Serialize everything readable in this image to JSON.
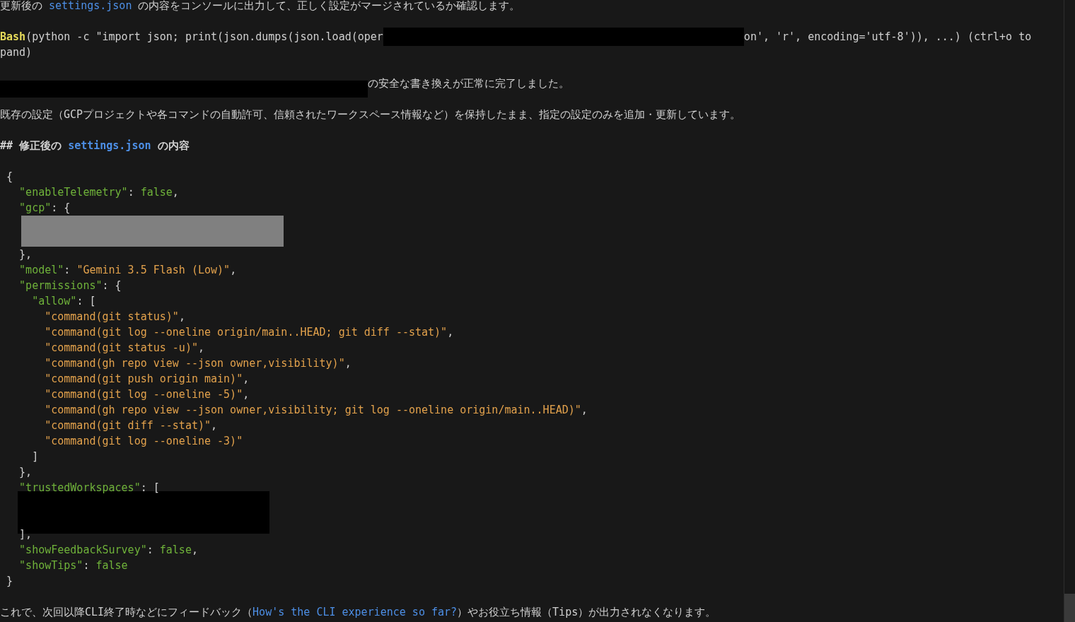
{
  "lines": [
    {
      "kind": "prose",
      "segs": [
        {
          "t": "更新後の ",
          "kind": "plain"
        },
        {
          "t": "settings.json",
          "kind": "link"
        },
        {
          "t": " の内容をコンソールに出力して、正しく設定がマージされているか確認します。",
          "kind": "plain"
        }
      ]
    },
    {
      "kind": "blank"
    },
    {
      "kind": "tool",
      "segs": [
        {
          "t": "Bash",
          "kind": "tool"
        },
        {
          "t": "(python -c \"import json; print(json.dumps(json.load(oper",
          "kind": "plain"
        },
        {
          "kind": "mask",
          "color": "#000000"
        },
        {
          "t": "on', 'r', encoding='utf-8')), ...) (ctrl+o to",
          "kind": "plain"
        }
      ]
    },
    {
      "kind": "tool",
      "segs": [
        {
          "t": "pand)",
          "kind": "plain"
        }
      ]
    },
    {
      "kind": "blank"
    },
    {
      "kind": "prose",
      "segs": [
        {
          "kind": "mask",
          "color": "#000000"
        },
        {
          "t": "の安全な書き換えが正常に完了しました。",
          "kind": "plain"
        }
      ]
    },
    {
      "kind": "blank"
    },
    {
      "kind": "prose",
      "segs": [
        {
          "t": "既存の設定（GCPプロジェクトや各コマンドの自動許可、信頼されたワークスペース情報など）を保持したまま、指定の設定のみを追加・更新しています。",
          "kind": "plain"
        }
      ]
    },
    {
      "kind": "blank"
    },
    {
      "kind": "heading",
      "segs": [
        {
          "t": "## 修正後の ",
          "kind": "plain"
        },
        {
          "t": "settings.json",
          "kind": "link"
        },
        {
          "t": " の内容",
          "kind": "plain"
        }
      ]
    },
    {
      "kind": "blank"
    },
    {
      "kind": "code",
      "segs": [
        {
          "t": " {",
          "kind": "punct"
        }
      ]
    },
    {
      "kind": "code",
      "segs": [
        {
          "t": "   \"enableTelemetry\"",
          "kind": "key"
        },
        {
          "t": ": ",
          "kind": "punct"
        },
        {
          "t": "false",
          "kind": "bool"
        },
        {
          "t": ",",
          "kind": "punct"
        }
      ]
    },
    {
      "kind": "code",
      "segs": [
        {
          "t": "   \"gcp\"",
          "kind": "key"
        },
        {
          "t": ": {",
          "kind": "punct"
        }
      ]
    },
    {
      "kind": "mask",
      "color": "#808080"
    },
    {
      "kind": "code",
      "segs": [
        {
          "t": "   },",
          "kind": "punct"
        }
      ]
    },
    {
      "kind": "code",
      "segs": [
        {
          "t": "   \"model\"",
          "kind": "key"
        },
        {
          "t": ": ",
          "kind": "punct"
        },
        {
          "t": "\"Gemini 3.5 Flash (Low)\"",
          "kind": "str"
        },
        {
          "t": ",",
          "kind": "punct"
        }
      ]
    },
    {
      "kind": "code",
      "segs": [
        {
          "t": "   \"permissions\"",
          "kind": "key"
        },
        {
          "t": ": {",
          "kind": "punct"
        }
      ]
    },
    {
      "kind": "code",
      "segs": [
        {
          "t": "     \"allow\"",
          "kind": "key"
        },
        {
          "t": ": [",
          "kind": "punct"
        }
      ]
    },
    {
      "kind": "code",
      "segs": [
        {
          "t": "       \"command(git status)\"",
          "kind": "str"
        },
        {
          "t": ",",
          "kind": "punct"
        }
      ]
    },
    {
      "kind": "code",
      "segs": [
        {
          "t": "       \"command(git log --oneline origin/main..HEAD; git diff --stat)\"",
          "kind": "str"
        },
        {
          "t": ",",
          "kind": "punct"
        }
      ]
    },
    {
      "kind": "code",
      "segs": [
        {
          "t": "       \"command(git status -u)\"",
          "kind": "str"
        },
        {
          "t": ",",
          "kind": "punct"
        }
      ]
    },
    {
      "kind": "code",
      "segs": [
        {
          "t": "       \"command(gh repo view --json owner,visibility)\"",
          "kind": "str"
        },
        {
          "t": ",",
          "kind": "punct"
        }
      ]
    },
    {
      "kind": "code",
      "segs": [
        {
          "t": "       \"command(git push origin main)\"",
          "kind": "str"
        },
        {
          "t": ",",
          "kind": "punct"
        }
      ]
    },
    {
      "kind": "code",
      "segs": [
        {
          "t": "       \"command(git log --oneline -5)\"",
          "kind": "str"
        },
        {
          "t": ",",
          "kind": "punct"
        }
      ]
    },
    {
      "kind": "code",
      "segs": [
        {
          "t": "       \"command(gh repo view --json owner,visibility; git log --oneline origin/main..HEAD)\"",
          "kind": "str"
        },
        {
          "t": ",",
          "kind": "punct"
        }
      ]
    },
    {
      "kind": "code",
      "segs": [
        {
          "t": "       \"command(git diff --stat)\"",
          "kind": "str"
        },
        {
          "t": ",",
          "kind": "punct"
        }
      ]
    },
    {
      "kind": "code",
      "segs": [
        {
          "t": "       \"command(git log --oneline -3)\"",
          "kind": "str"
        }
      ]
    },
    {
      "kind": "code",
      "segs": [
        {
          "t": "     ]",
          "kind": "punct"
        }
      ]
    },
    {
      "kind": "code",
      "segs": [
        {
          "t": "   },",
          "kind": "punct"
        }
      ]
    },
    {
      "kind": "code",
      "segs": [
        {
          "t": "   \"trustedWorkspaces\"",
          "kind": "key"
        },
        {
          "t": ": [",
          "kind": "punct"
        }
      ]
    },
    {
      "kind": "mask",
      "color": "#000000"
    },
    {
      "kind": "code",
      "segs": [
        {
          "t": "   ],",
          "kind": "punct"
        }
      ]
    },
    {
      "kind": "code",
      "segs": [
        {
          "t": "   \"showFeedbackSurvey\"",
          "kind": "key"
        },
        {
          "t": ": ",
          "kind": "punct"
        },
        {
          "t": "false",
          "kind": "bool"
        },
        {
          "t": ",",
          "kind": "punct"
        }
      ]
    },
    {
      "kind": "code",
      "segs": [
        {
          "t": "   \"showTips\"",
          "kind": "key"
        },
        {
          "t": ": ",
          "kind": "punct"
        },
        {
          "t": "false",
          "kind": "bool"
        }
      ]
    },
    {
      "kind": "code",
      "segs": [
        {
          "t": " }",
          "kind": "punct"
        }
      ]
    },
    {
      "kind": "blank"
    },
    {
      "kind": "prose",
      "segs": [
        {
          "t": "これで、次回以降CLI終了時などにフィードバック（",
          "kind": "plain"
        },
        {
          "t": "How's the CLI experience so far?",
          "kind": "link"
        },
        {
          "t": "）やお役立ち情報（Tips）が出力されなくなります。",
          "kind": "plain"
        }
      ]
    }
  ]
}
